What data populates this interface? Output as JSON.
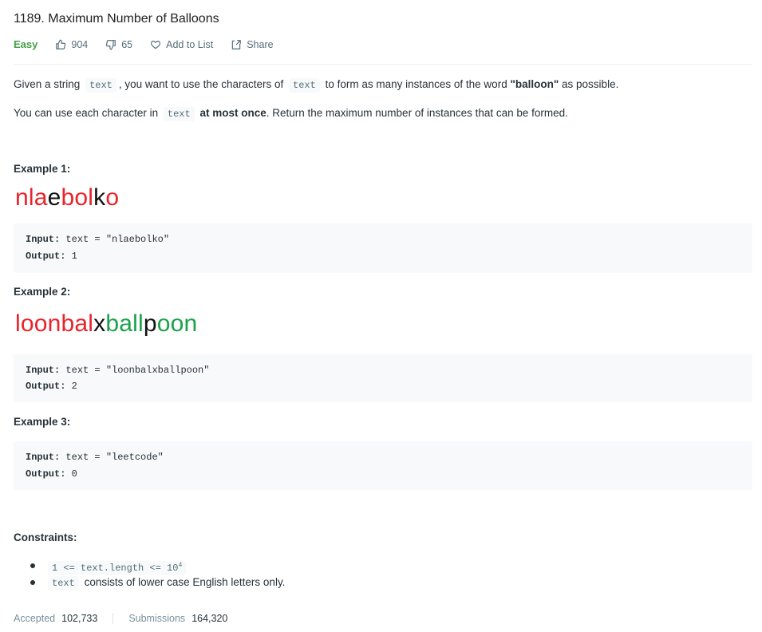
{
  "problem": {
    "title": "1189. Maximum Number of Balloons",
    "difficulty": "Easy",
    "likes": "904",
    "dislikes": "65",
    "add_to_list": "Add to List",
    "share": "Share"
  },
  "description": {
    "p1_a": "Given a string",
    "p1_code1": "text",
    "p1_b": ", you want to use the characters of",
    "p1_code2": "text",
    "p1_c": "to form as many instances of the word",
    "p1_bold": "\"balloon\"",
    "p1_d": "as possible.",
    "p2_a": "You can use each character in",
    "p2_code": "text",
    "p2_bold": "at most once",
    "p2_b": ". Return the maximum number of instances that can be formed."
  },
  "examples": [
    {
      "heading": "Example 1:",
      "word_segments": [
        {
          "text": "nla",
          "color": "#e8232b"
        },
        {
          "text": "e",
          "color": "#111111"
        },
        {
          "text": "bol",
          "color": "#e8232b"
        },
        {
          "text": "k",
          "color": "#111111"
        },
        {
          "text": "o",
          "color": "#e8232b"
        }
      ],
      "input_label": "Input:",
      "input_value": "text = \"nlaebolko\"",
      "output_label": "Output:",
      "output_value": "1"
    },
    {
      "heading": "Example 2:",
      "word_segments": [
        {
          "text": "loonbal",
          "color": "#e8232b"
        },
        {
          "text": "x",
          "color": "#111111"
        },
        {
          "text": "ball",
          "color": "#19a24a"
        },
        {
          "text": "p",
          "color": "#111111"
        },
        {
          "text": "oon",
          "color": "#19a24a"
        }
      ],
      "input_label": "Input:",
      "input_value": "text = \"loonbalxballpoon\"",
      "output_label": "Output:",
      "output_value": "2"
    },
    {
      "heading": "Example 3:",
      "input_label": "Input:",
      "input_value": "text = \"leetcode\"",
      "output_label": "Output:",
      "output_value": "0"
    }
  ],
  "constraints": {
    "heading": "Constraints:",
    "c1_code": "1 <= text.length <= 10",
    "c1_sup": "4",
    "c2_code": "text",
    "c2_text": "consists of lower case English letters only."
  },
  "stats": {
    "accepted_label": "Accepted",
    "accepted_value": "102,733",
    "submissions_label": "Submissions",
    "submissions_value": "164,320"
  },
  "colors": {
    "easy": "#43a047",
    "red_letters": "#e8232b",
    "green_letters": "#19a24a"
  },
  "icons": [
    "thumbs-up-icon",
    "thumbs-down-icon",
    "heart-icon",
    "share-icon"
  ]
}
